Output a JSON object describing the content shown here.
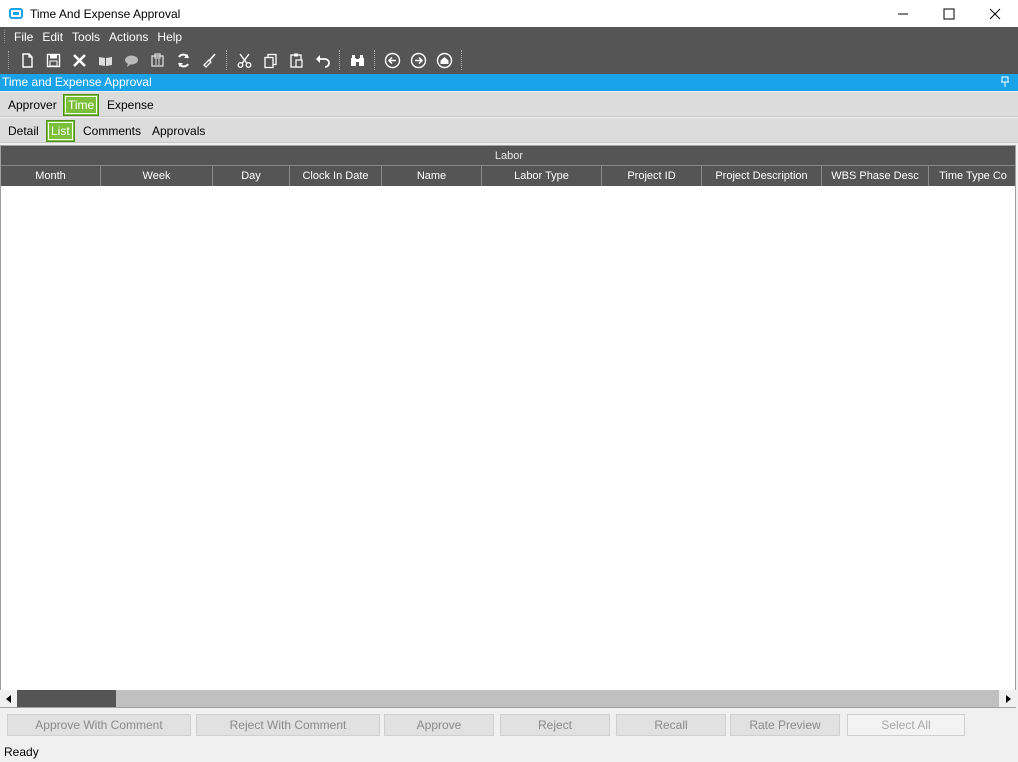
{
  "window": {
    "title": "Time And Expense Approval"
  },
  "menu": [
    "File",
    "Edit",
    "Tools",
    "Actions",
    "Help"
  ],
  "panel": {
    "title": "Time and Expense Approval"
  },
  "tabs_level1": [
    {
      "label": "Approver",
      "active": false
    },
    {
      "label": "Time",
      "active": true
    },
    {
      "label": "Expense",
      "active": false
    }
  ],
  "tabs_level2": [
    {
      "label": "Detail",
      "active": false
    },
    {
      "label": "List",
      "active": true
    },
    {
      "label": "Comments",
      "active": false
    },
    {
      "label": "Approvals",
      "active": false
    }
  ],
  "grid": {
    "band_label": "Labor",
    "columns": [
      "Month",
      "Week",
      "Day",
      "Clock In Date",
      "Name",
      "Labor Type",
      "Project ID",
      "Project Description",
      "WBS Phase Desc",
      "Time Type Co"
    ]
  },
  "actions": {
    "approve_with_comment": "Approve With Comment",
    "reject_with_comment": "Reject With Comment",
    "approve": "Approve",
    "reject": "Reject",
    "recall": "Recall",
    "rate_preview": "Rate Preview",
    "select_all": "Select All"
  },
  "status": {
    "text": "Ready"
  },
  "colors": {
    "accent": "#1aa3e8",
    "active_tab": "#7cbf3a",
    "toolbar": "#555555"
  }
}
